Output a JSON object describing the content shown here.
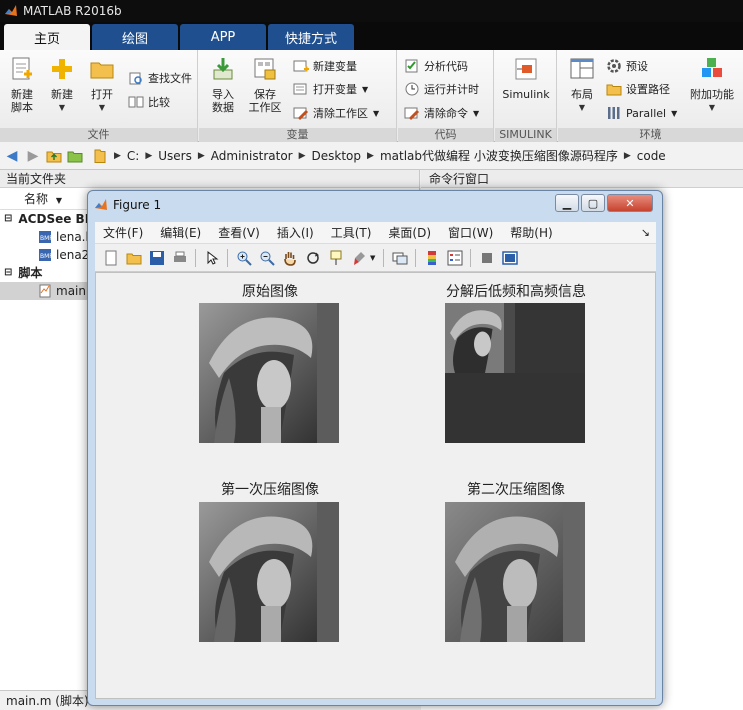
{
  "window": {
    "title": "MATLAB R2016b"
  },
  "tabs": [
    {
      "label": "主页",
      "active": true
    },
    {
      "label": "绘图",
      "active": false
    },
    {
      "label": "APP",
      "active": false
    },
    {
      "label": "快捷方式",
      "active": false
    }
  ],
  "ribbon": {
    "file": {
      "label": "文件",
      "new_script": "新建\n脚本",
      "new": "新建",
      "open": "打开",
      "find_files": "查找文件",
      "compare": "比较"
    },
    "variable": {
      "label": "变量",
      "import": "导入\n数据",
      "save_ws": "保存\n工作区",
      "new_var": "新建变量",
      "open_var": "打开变量",
      "clear_ws": "清除工作区"
    },
    "code": {
      "label": "代码",
      "analyze": "分析代码",
      "run_time": "运行并计时",
      "clear_cmd": "清除命令"
    },
    "simulink": {
      "label": "SIMULINK",
      "simulink": "Simulink"
    },
    "env": {
      "label": "环境",
      "layout": "布局",
      "prefs": "预设",
      "set_path": "设置路径",
      "parallel": "Parallel",
      "addons": "附加功能"
    }
  },
  "address": {
    "crumbs": [
      "C:",
      "Users",
      "Administrator",
      "Desktop",
      "matlab代做编程 小波变换压缩图像源码程序",
      "code"
    ]
  },
  "current_folder": {
    "title": "当前文件夹",
    "col_name": "名称",
    "groups": [
      {
        "label": "ACDSee BM",
        "files": [
          "lena.b",
          "lena2"
        ]
      },
      {
        "label": "脚本",
        "files": [
          "main."
        ]
      }
    ],
    "status": "main.m  (脚本)"
  },
  "command_window": {
    "title": "命令行窗口"
  },
  "figure": {
    "title": "Figure 1",
    "menu": [
      "文件(F)",
      "编辑(E)",
      "查看(V)",
      "插入(I)",
      "工具(T)",
      "桌面(D)",
      "窗口(W)",
      "帮助(H)"
    ],
    "plots": [
      {
        "title": "原始图像"
      },
      {
        "title": "分解后低频和高频信息"
      },
      {
        "title": "第一次压缩图像"
      },
      {
        "title": "第二次压缩图像"
      }
    ]
  },
  "colors": {
    "tab_blue": "#1f4f8f",
    "titlebar": "#0d0d0d",
    "matlab_orange": "#e8731e"
  }
}
